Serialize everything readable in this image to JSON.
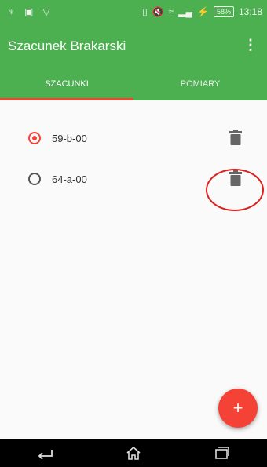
{
  "status_bar": {
    "left_icons": [
      "usb-icon",
      "image-icon",
      "download-icon"
    ],
    "right_icons": [
      "sim-icon",
      "mute-icon",
      "wifi-icon",
      "signal-icon",
      "charging-icon"
    ],
    "battery": "58%",
    "time": "13:18"
  },
  "app_bar": {
    "title": "Szacunek Brakarski",
    "menu_icon": "more-vert-icon"
  },
  "tabs": [
    {
      "label": "SZACUNKI",
      "active": true
    },
    {
      "label": "POMIARY",
      "active": false
    }
  ],
  "estimates": [
    {
      "label": "59-b-00",
      "selected": true
    },
    {
      "label": "64-a-00",
      "selected": false
    }
  ],
  "fab": {
    "label": "+"
  },
  "colors": {
    "primary": "#4caf50",
    "accent": "#f44336",
    "annotation": "#e02020"
  }
}
